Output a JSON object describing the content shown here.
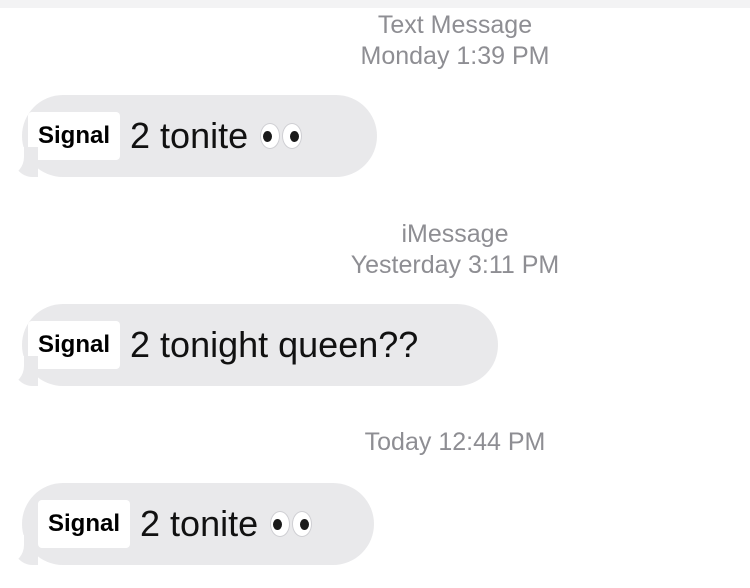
{
  "thread": {
    "groups": [
      {
        "service": "Text Message",
        "timestamp": "Monday 1:39 PM",
        "message": {
          "sender_label": "Signal",
          "text": "2 tonite",
          "emoji_icon": "eyes-icon"
        }
      },
      {
        "service": "iMessage",
        "timestamp": "Yesterday 3:11 PM",
        "message": {
          "sender_label": "Signal",
          "text": "2 tonight queen??"
        }
      },
      {
        "service": "",
        "timestamp": "Today 12:44 PM",
        "message": {
          "sender_label": "Signal",
          "text": "2 tonite",
          "emoji_icon": "eyes-icon"
        }
      }
    ]
  },
  "colors": {
    "bubble_incoming": "#e9e9eb",
    "timestamp_text": "#8e8e93",
    "message_text": "#111111",
    "label_background": "#ffffff"
  }
}
